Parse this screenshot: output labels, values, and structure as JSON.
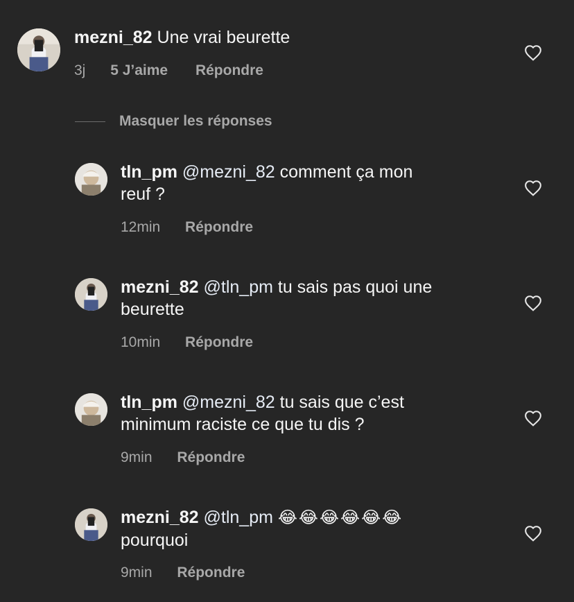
{
  "main_comment": {
    "username": "mezni_82",
    "text": "Une vrai beurette",
    "time": "3j",
    "likes": "5 J’aime",
    "reply": "Répondre"
  },
  "hide_replies": "Masquer les réponses",
  "replies": [
    {
      "username": "tln_pm",
      "mention": "@mezni_82",
      "text": "comment ça mon",
      "text2": "reuf ?",
      "time": "12min",
      "reply": "Répondre"
    },
    {
      "username": "mezni_82",
      "mention": "@tln_pm",
      "text": "tu sais pas quoi une",
      "text2": "beurette",
      "time": "10min",
      "reply": "Répondre"
    },
    {
      "username": "tln_pm",
      "mention": "@mezni_82",
      "text": "tu sais que c’est",
      "text2": "minimum raciste ce que tu dis ?",
      "time": "9min",
      "reply": "Répondre"
    },
    {
      "username": "mezni_82",
      "mention": "@tln_pm",
      "text": "😂😂😂😂😂😂",
      "text2": "pourquoi",
      "time": "9min",
      "reply": "Répondre"
    }
  ],
  "icons": {
    "like": "heart-icon",
    "avatar": "avatar"
  }
}
